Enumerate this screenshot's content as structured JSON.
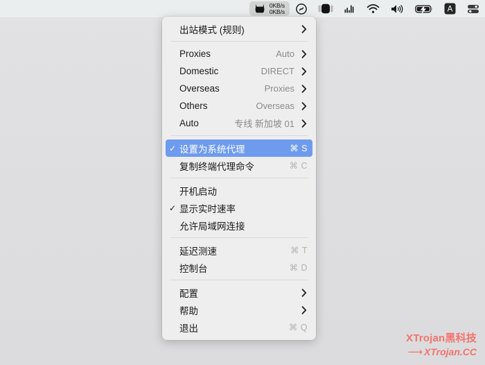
{
  "menubar": {
    "clashx": {
      "icon": "cat-icon",
      "upload_speed": "0KB/s",
      "download_speed": "0KB/s"
    },
    "items": [
      {
        "name": "shazam-icon",
        "label": "Shazam"
      },
      {
        "name": "screen-mirroring-icon",
        "label": "Screen Mirroring"
      },
      {
        "name": "audio-levels-icon",
        "label": "Audio Levels"
      },
      {
        "name": "wifi-icon",
        "label": "Wi-Fi"
      },
      {
        "name": "volume-icon",
        "label": "Volume"
      },
      {
        "name": "battery-charging-icon",
        "label": "Battery"
      },
      {
        "name": "input-source-icon",
        "label": "A"
      },
      {
        "name": "control-center-icon",
        "label": "Control Center"
      }
    ]
  },
  "menu": {
    "groups": [
      {
        "rows": [
          {
            "label": "出站模式 (规则)",
            "checked": false,
            "value": "",
            "shortcut": "",
            "submenu": true,
            "highlight": false
          }
        ]
      },
      {
        "rows": [
          {
            "label": "Proxies",
            "checked": false,
            "value": "Auto",
            "shortcut": "",
            "submenu": true,
            "highlight": false
          },
          {
            "label": "Domestic",
            "checked": false,
            "value": "DIRECT",
            "shortcut": "",
            "submenu": true,
            "highlight": false
          },
          {
            "label": "Overseas",
            "checked": false,
            "value": "Proxies",
            "shortcut": "",
            "submenu": true,
            "highlight": false
          },
          {
            "label": "Others",
            "checked": false,
            "value": "Overseas",
            "shortcut": "",
            "submenu": true,
            "highlight": false
          },
          {
            "label": "Auto",
            "checked": false,
            "value": "专线 新加坡 01",
            "shortcut": "",
            "submenu": true,
            "highlight": false
          }
        ]
      },
      {
        "rows": [
          {
            "label": "设置为系统代理",
            "checked": true,
            "value": "",
            "shortcut": "⌘ S",
            "submenu": false,
            "highlight": true
          },
          {
            "label": "复制终端代理命令",
            "checked": false,
            "value": "",
            "shortcut": "⌘ C",
            "submenu": false,
            "highlight": false
          }
        ]
      },
      {
        "rows": [
          {
            "label": "开机启动",
            "checked": false,
            "value": "",
            "shortcut": "",
            "submenu": false,
            "highlight": false
          },
          {
            "label": "显示实时速率",
            "checked": true,
            "value": "",
            "shortcut": "",
            "submenu": false,
            "highlight": false
          },
          {
            "label": "允许局域网连接",
            "checked": false,
            "value": "",
            "shortcut": "",
            "submenu": false,
            "highlight": false
          }
        ]
      },
      {
        "rows": [
          {
            "label": "延迟测速",
            "checked": false,
            "value": "",
            "shortcut": "⌘ T",
            "submenu": false,
            "highlight": false
          },
          {
            "label": "控制台",
            "checked": false,
            "value": "",
            "shortcut": "⌘ D",
            "submenu": false,
            "highlight": false
          }
        ]
      },
      {
        "rows": [
          {
            "label": "配置",
            "checked": false,
            "value": "",
            "shortcut": "",
            "submenu": true,
            "highlight": false
          },
          {
            "label": "帮助",
            "checked": false,
            "value": "",
            "shortcut": "",
            "submenu": true,
            "highlight": false
          },
          {
            "label": "退出",
            "checked": false,
            "value": "",
            "shortcut": "⌘ Q",
            "submenu": false,
            "highlight": false
          }
        ]
      }
    ],
    "checkmark_glyph": "✓",
    "chevron_glyph": "›"
  },
  "watermark": {
    "line1": "XTrojan黑科技",
    "arrow": "⟶",
    "line2": "XTrojan.CC",
    "color": "#f4726c"
  },
  "colors": {
    "menubar_bg": "#ebeeee",
    "desktop_bg": "#e0e0e2",
    "menu_bg": "#eeeeee",
    "highlight": "#6e9bee",
    "shortcut_text": "#b2b2b2",
    "value_text": "#8a8a8a"
  }
}
